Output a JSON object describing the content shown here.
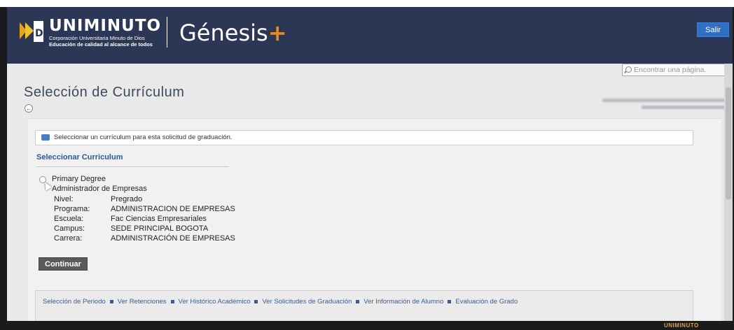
{
  "header": {
    "brand_name": "UNIMINUTO",
    "brand_sub1": "Corporación Universitaria Minuto de Dios",
    "brand_sub2": "Educación de calidad al alcance de todos",
    "app_name": "Génesis",
    "app_plus": "+",
    "logout_label": "Salir"
  },
  "search": {
    "placeholder": "Encontrar una página."
  },
  "page": {
    "title": "Selección de Currículum"
  },
  "info_message": "Seleccionar un currículum para esta solicitud de graduación.",
  "section": {
    "title": "Seleccionar Curriculum"
  },
  "curriculum": {
    "degree": "Primary Degree",
    "program_name": "Administrador de Empresas",
    "details": [
      {
        "label": "Nivel:",
        "value": "Pregrado"
      },
      {
        "label": "Programa:",
        "value": "ADMINISTRACION DE EMPRESAS"
      },
      {
        "label": "Escuela:",
        "value": "Fac Ciencias Empresariales"
      },
      {
        "label": "Campus:",
        "value": "SEDE PRINCIPAL BOGOTA"
      },
      {
        "label": "Carrera:",
        "value": "ADMINISTRACIÓN DE EMPRESAS"
      }
    ]
  },
  "actions": {
    "continue_label": "Continuar"
  },
  "footer_links": [
    "Selección de Periodo",
    "Ver Retenciones",
    "Ver Histórico Académico",
    "Ver Solicitudes de Graduación",
    "Ver Información de Alumno",
    "Evaluación de Grado"
  ],
  "footer_logo": "UNIMINUTO",
  "colors": {
    "header_bg": "#2b3754",
    "accent_orange": "#e98b1b",
    "salir_blue": "#2f6fc4",
    "link_blue": "#2f5f9e"
  },
  "icons": [
    "logo-mark-icon",
    "search-icon",
    "back-arrow-icon",
    "info-message-icon",
    "radio-icon"
  ]
}
